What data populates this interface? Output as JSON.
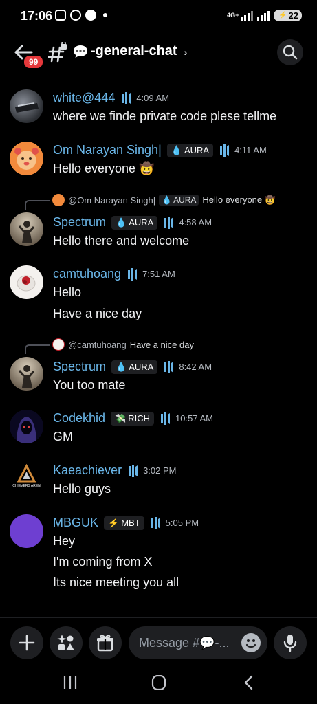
{
  "status_bar": {
    "time": "17:06",
    "network": "4G+",
    "battery": "22"
  },
  "header": {
    "unread_badge": "99",
    "channel_name": "-general-chat"
  },
  "messages": [
    {
      "author": "white@444",
      "time": "4:09 AM",
      "lines": [
        "where we finde  private code plese tellme"
      ]
    },
    {
      "author": "Om Narayan Singh|",
      "tag": "AURA",
      "time": "4:11 AM",
      "lines": [
        "Hello everyone 🤠"
      ]
    },
    {
      "reply": {
        "author": "@Om Narayan Singh|",
        "tag": "AURA",
        "text": "Hello everyone 🤠"
      },
      "author": "Spectrum",
      "tag": "AURA",
      "time": "4:58 AM",
      "lines": [
        "Hello there and welcome"
      ]
    },
    {
      "author": "camtuhoang",
      "time": "7:51 AM",
      "lines": [
        "Hello",
        "Have a nice day"
      ]
    },
    {
      "reply": {
        "author": "@camtuhoang",
        "text": "Have a nice day"
      },
      "author": "Spectrum",
      "tag": "AURA",
      "time": "8:42 AM",
      "lines": [
        "You too mate"
      ]
    },
    {
      "author": "Codekhid",
      "tag": "RICH",
      "time": "10:57 AM",
      "lines": [
        "GM"
      ]
    },
    {
      "author": "Kaeachiever",
      "time": "3:02 PM",
      "lines": [
        "Hello guys"
      ],
      "avatar_text": "CHIEVERS AREN"
    },
    {
      "author": "MBGUK",
      "tag": "MBT",
      "time": "5:05 PM",
      "lines": [
        "Hey",
        "I'm coming from X",
        "Its nice meeting you all"
      ]
    }
  ],
  "composer": {
    "placeholder": "Message #💬-..."
  },
  "colors": {
    "username": "#6ab6e8",
    "badge": "#e5383b",
    "background": "#000000",
    "surface": "#1e1f22"
  }
}
